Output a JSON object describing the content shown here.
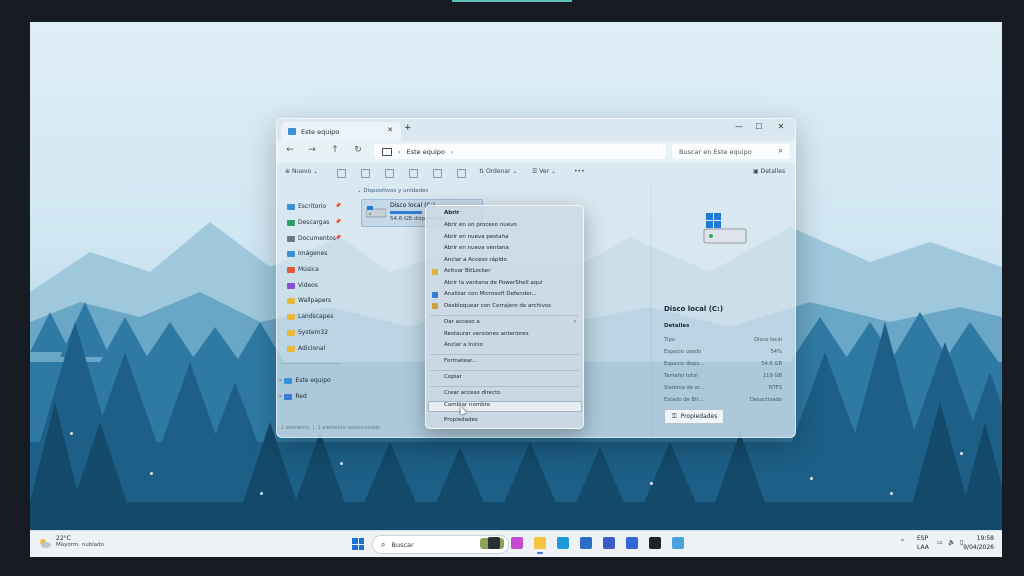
{
  "window": {
    "tab_title": "Este equipo",
    "address_path": "Este equipo",
    "search_placeholder": "Buscar en Este equipo"
  },
  "commandbar": {
    "new_label": "Nuevo",
    "sort_label": "Ordenar",
    "view_label": "Ver",
    "more_label": "•••",
    "details_label": "Detalles"
  },
  "sidebar": {
    "items": [
      {
        "label": "Escritorio",
        "color": "#3b8fd6"
      },
      {
        "label": "Descargas",
        "color": "#2e9e6a"
      },
      {
        "label": "Documentos",
        "color": "#6b7a8a"
      },
      {
        "label": "Imágenes",
        "color": "#3a90d8"
      },
      {
        "label": "Música",
        "color": "#e0593a"
      },
      {
        "label": "Videos",
        "color": "#8a4fd0"
      },
      {
        "label": "Wallpapers",
        "color": "#e8b83a"
      },
      {
        "label": "Landscapes",
        "color": "#e8b83a"
      },
      {
        "label": "System32",
        "color": "#e8b83a"
      },
      {
        "label": "Adicional",
        "color": "#e8b83a"
      }
    ],
    "this_pc": "Este equipo",
    "network": "Red"
  },
  "content": {
    "group_label": "Dispositivos y unidades",
    "drive_name": "Disco local (C:)",
    "drive_space": "54.6 GB disponibles",
    "drive_usage_fraction": 0.54
  },
  "status": {
    "count": "1 elemento",
    "selected": "1 elemento seleccionado"
  },
  "details_pane": {
    "title": "Disco local (C:)",
    "section": "Detalles",
    "rows": [
      {
        "key": "Tipo",
        "value": "Disco local"
      },
      {
        "key": "Espacio usado",
        "value": "54%"
      },
      {
        "key": "Espacio dispo...",
        "value": "54.6 GB"
      },
      {
        "key": "Tamaño total",
        "value": "119 GB"
      },
      {
        "key": "Sistema de ar...",
        "value": "NTFS"
      },
      {
        "key": "Estado de Bit...",
        "value": "Desactivado"
      }
    ],
    "properties_button": "Propiedades"
  },
  "context_menu": {
    "items": [
      {
        "label": "Abrir",
        "bold": true
      },
      {
        "label": "Abrir en un proceso nuevo"
      },
      {
        "label": "Abrir en nueva pestaña"
      },
      {
        "label": "Abrir en nueva ventana"
      },
      {
        "label": "Anclar a Acceso rápido"
      },
      {
        "label": "Activar BitLocker"
      },
      {
        "label": "Abrir la ventana de PowerShell aquí"
      },
      {
        "label": "Analizar con Microsoft Defender..."
      },
      {
        "label": "Desbloquear con Cerrajero de archivos"
      },
      {
        "label": "Dar acceso a"
      },
      {
        "label": "Restaurar versiones anteriores"
      },
      {
        "label": "Anclar a Inicio"
      },
      {
        "label": "Formatear..."
      },
      {
        "label": "Copiar"
      },
      {
        "label": "Crear acceso directo"
      },
      {
        "label": "Cambiar nombre"
      },
      {
        "label": "Propiedades"
      }
    ]
  },
  "taskbar": {
    "temperature": "22°C",
    "condition": "Mayorm. nublado",
    "search_label": "Buscar",
    "lang_top": "ESP",
    "lang_bottom": "LAA",
    "time": "19:58",
    "date": "9/04/2026",
    "chevron": "^"
  }
}
